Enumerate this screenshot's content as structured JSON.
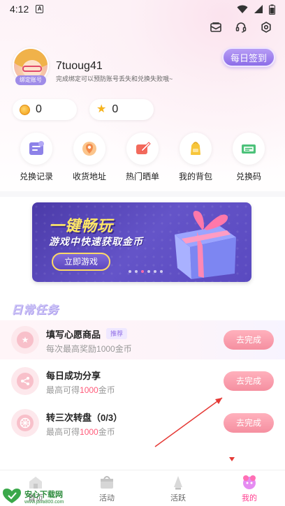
{
  "status_bar": {
    "time": "4:12",
    "sim_label": "A"
  },
  "header": {
    "icons": [
      "mail-icon",
      "headset-icon",
      "settings-icon"
    ]
  },
  "profile": {
    "username": "7tuoug41",
    "bind_badge": "绑定账号",
    "bind_tip": "完成绑定可以预防账号丢失和兑换失败哦~",
    "signin_label": "每日签到"
  },
  "balances": [
    {
      "icon": "coin-icon",
      "value": "0"
    },
    {
      "icon": "star-icon",
      "value": "0"
    }
  ],
  "quick_menu": [
    {
      "label": "兑换记录",
      "icon": "exchange-record-icon",
      "color": "#7a6de0"
    },
    {
      "label": "收货地址",
      "icon": "address-icon",
      "color": "#f7a25b"
    },
    {
      "label": "热门晒单",
      "icon": "hot-share-icon",
      "color": "#f2524c"
    },
    {
      "label": "我的背包",
      "icon": "backpack-icon",
      "color": "#f5c02b"
    },
    {
      "label": "兑换码",
      "icon": "redeem-code-icon",
      "color": "#3fbf6c"
    }
  ],
  "banner": {
    "title": "一键畅玩",
    "subtitle": "游戏中快速获取金币",
    "button": "立即游戏",
    "dot_count": 6,
    "active_dot": 3
  },
  "daily_tasks": {
    "title": "日常任务",
    "items": [
      {
        "title": "填写心愿商品",
        "tag": "推荐",
        "sub_prefix": "每次最高奖励",
        "sub_highlight": "1000",
        "sub_suffix": "金币",
        "button": "去完成"
      },
      {
        "title": "每日成功分享",
        "tag": "",
        "sub_prefix": "最高可得",
        "sub_highlight": "1000",
        "sub_suffix": "金币",
        "button": "去完成"
      },
      {
        "title": "转三次转盘（0/3）",
        "tag": "",
        "sub_prefix": "最高可得",
        "sub_highlight": "1000",
        "sub_suffix": "金币",
        "button": "去完成"
      }
    ]
  },
  "tabbar": {
    "tabs": [
      {
        "label": "首页",
        "active": false
      },
      {
        "label": "活动",
        "active": false
      },
      {
        "label": "活跃",
        "active": false
      },
      {
        "label": "我的",
        "active": true
      }
    ]
  },
  "watermark": {
    "main": "安心下载网",
    "url": "www.java800.com"
  },
  "colors": {
    "accent": "#8c6de8",
    "task_button": "#f58fa0",
    "highlight": "#ff5b7a",
    "active_tab": "#ff3d8e"
  }
}
